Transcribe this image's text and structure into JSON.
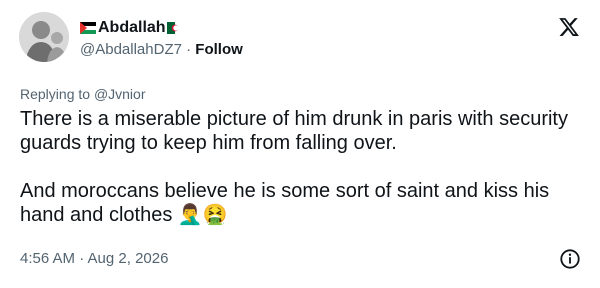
{
  "author": {
    "display_name": "Abdallah",
    "handle": "@AbdallahDZ7",
    "separator": " · ",
    "follow_label": "Follow",
    "avatar_icon": "profile-photo",
    "flags": [
      "palestine-flag-icon",
      "algeria-flag-icon"
    ]
  },
  "reply": {
    "prefix": "Replying to ",
    "mention": "@Jvnior"
  },
  "tweet": {
    "paragraph1": "There is a miserable picture of him drunk in paris with security guards trying to keep him from falling over.",
    "paragraph2": "And moroccans believe he is some sort of saint and kiss his hand and clothes 🤦‍♂️🤮"
  },
  "meta": {
    "timestamp": "4:56 AM · Aug 2, 2026"
  },
  "icons": {
    "brand": "x-logo-icon",
    "info": "info-icon"
  },
  "colors": {
    "text": "#0f1419",
    "secondary": "#536471"
  }
}
